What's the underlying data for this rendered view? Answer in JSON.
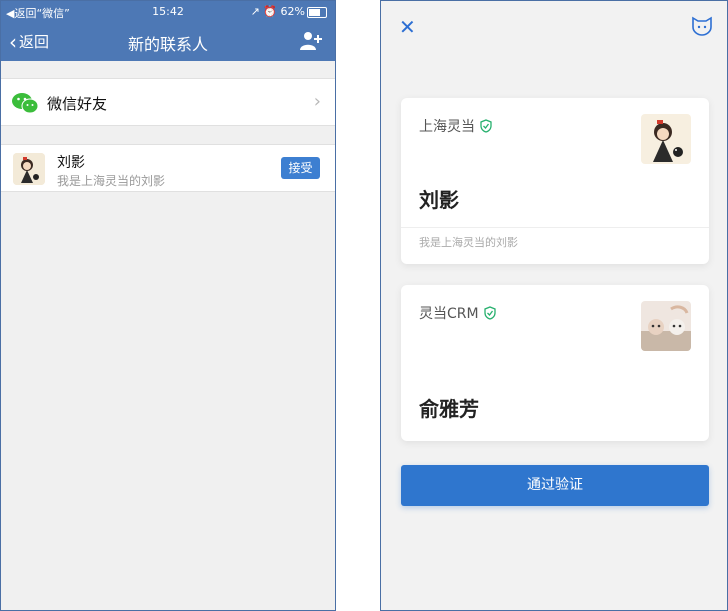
{
  "left": {
    "status": {
      "left": "◀︎返回“微信”",
      "time": "15:42",
      "right": "↗︎ ⏰ 62%"
    },
    "nav": {
      "back": "返回",
      "title": "新的联系人"
    },
    "wechat_row": {
      "label": "微信好友"
    },
    "contact": {
      "name": "刘影",
      "subtitle": "我是上海灵当的刘影",
      "accept": "接受"
    }
  },
  "right": {
    "card1": {
      "org": "上海灵当",
      "name": "刘影",
      "note": "我是上海灵当的刘影"
    },
    "card2": {
      "org": "灵当CRM",
      "name": "俞雅芳"
    },
    "verify_button": "通过验证"
  },
  "colors": {
    "accent": "#4d78b5",
    "button": "#2f76ce",
    "verified": "#27b06e",
    "wechat": "#3bbd3b"
  }
}
